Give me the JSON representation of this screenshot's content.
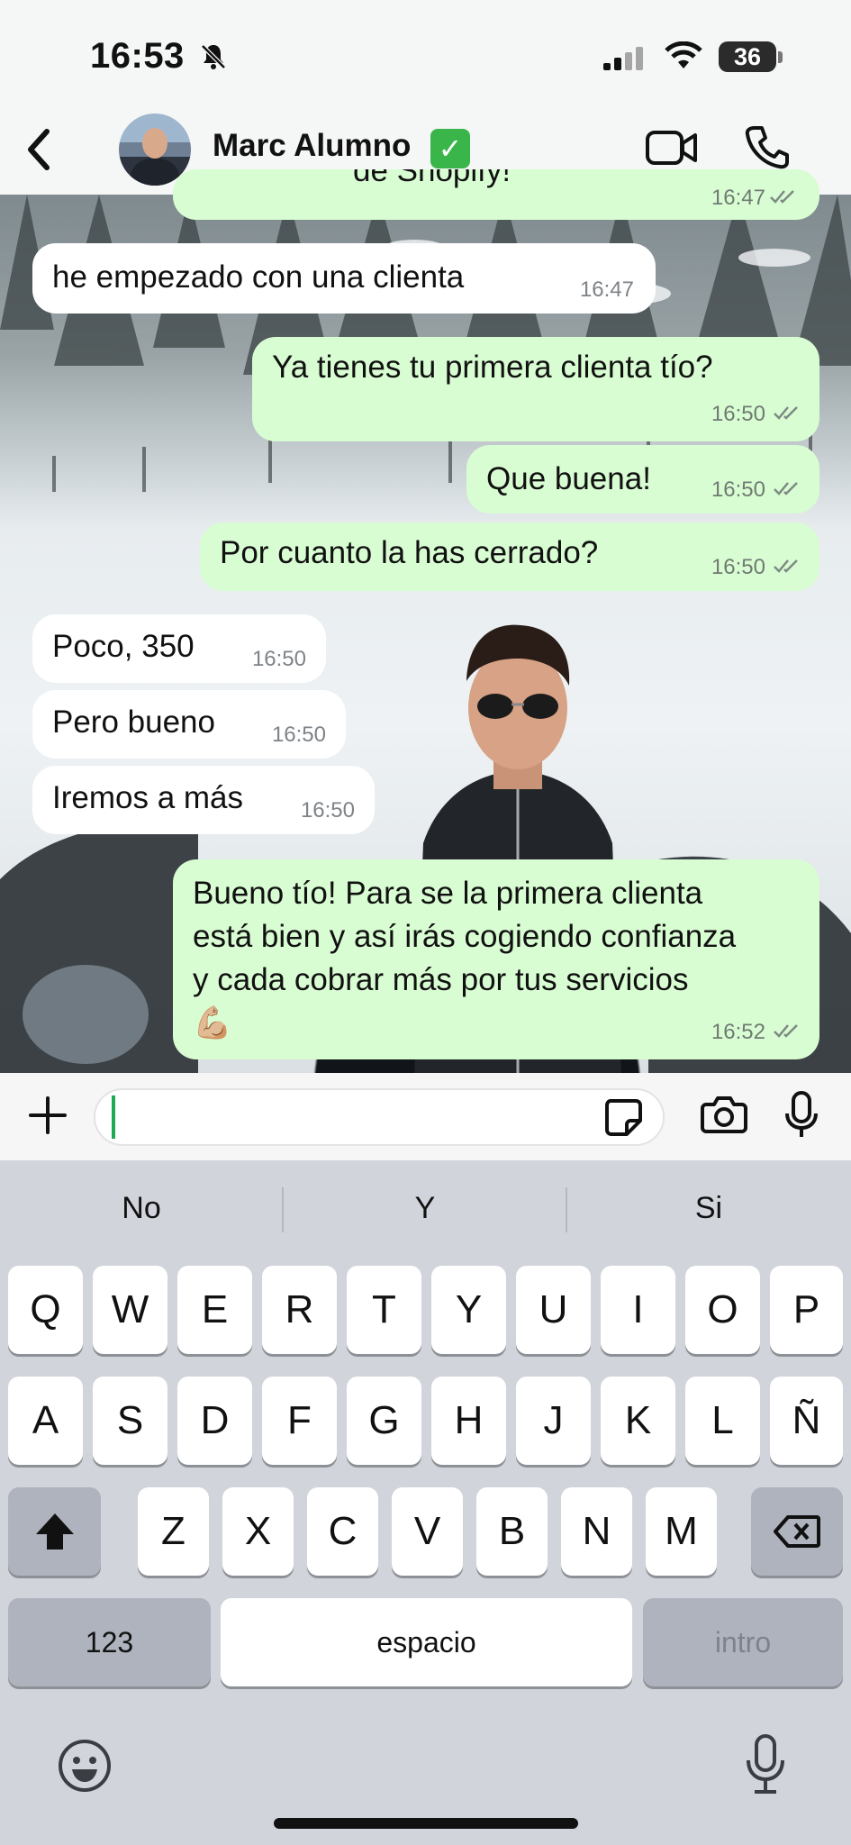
{
  "status": {
    "time": "16:53",
    "battery": "36"
  },
  "header": {
    "contact_name": "Marc Alumno",
    "verified_emoji": "✅"
  },
  "messages": [
    {
      "dir": "out",
      "text": "de Shopify!",
      "time": "16:47"
    },
    {
      "dir": "in",
      "text": "he empezado con una clienta",
      "time": "16:47"
    },
    {
      "dir": "out",
      "text": "Ya tienes tu primera clienta tío?",
      "time": "16:50"
    },
    {
      "dir": "out",
      "text": "Que buena!",
      "time": "16:50"
    },
    {
      "dir": "out",
      "text": "Por cuanto la has cerrado?",
      "time": "16:50"
    },
    {
      "dir": "in",
      "text": "Poco, 350",
      "time": "16:50"
    },
    {
      "dir": "in",
      "text": "Pero bueno",
      "time": "16:50"
    },
    {
      "dir": "in",
      "text": "Iremos a más",
      "time": "16:50"
    },
    {
      "dir": "out",
      "lines": [
        "Bueno tío! Para se la primera clienta",
        "está bien y así irás cogiendo confianza",
        "y cada cobrar más por tus servicios"
      ],
      "emoji": "💪🏼",
      "time": "16:52"
    }
  ],
  "input": {
    "value": "",
    "placeholder": ""
  },
  "keyboard": {
    "suggestions": [
      "No",
      "Y",
      "Si"
    ],
    "row1": [
      "Q",
      "W",
      "E",
      "R",
      "T",
      "Y",
      "U",
      "I",
      "O",
      "P"
    ],
    "row2": [
      "A",
      "S",
      "D",
      "F",
      "G",
      "H",
      "J",
      "K",
      "L",
      "Ñ"
    ],
    "row3": [
      "Z",
      "X",
      "C",
      "V",
      "B",
      "N",
      "M"
    ],
    "numbers": "123",
    "space": "espacio",
    "return": "intro"
  },
  "icons": {
    "header": [
      "back-arrow-icon",
      "video-call-icon",
      "phone-icon"
    ],
    "status": [
      "mute-bell-icon",
      "signal-icon",
      "wifi-icon"
    ],
    "input": [
      "plus-icon",
      "sticker-icon",
      "camera-icon",
      "microphone-icon"
    ],
    "keyboard": [
      "shift-icon",
      "backspace-icon",
      "emoji-icon",
      "dictation-mic-icon"
    ]
  },
  "colors": {
    "outgoing_bubble": "#d9fdd3",
    "incoming_bubble": "#ffffff",
    "ticks": "#7d8a84",
    "cursor": "#1da955"
  }
}
